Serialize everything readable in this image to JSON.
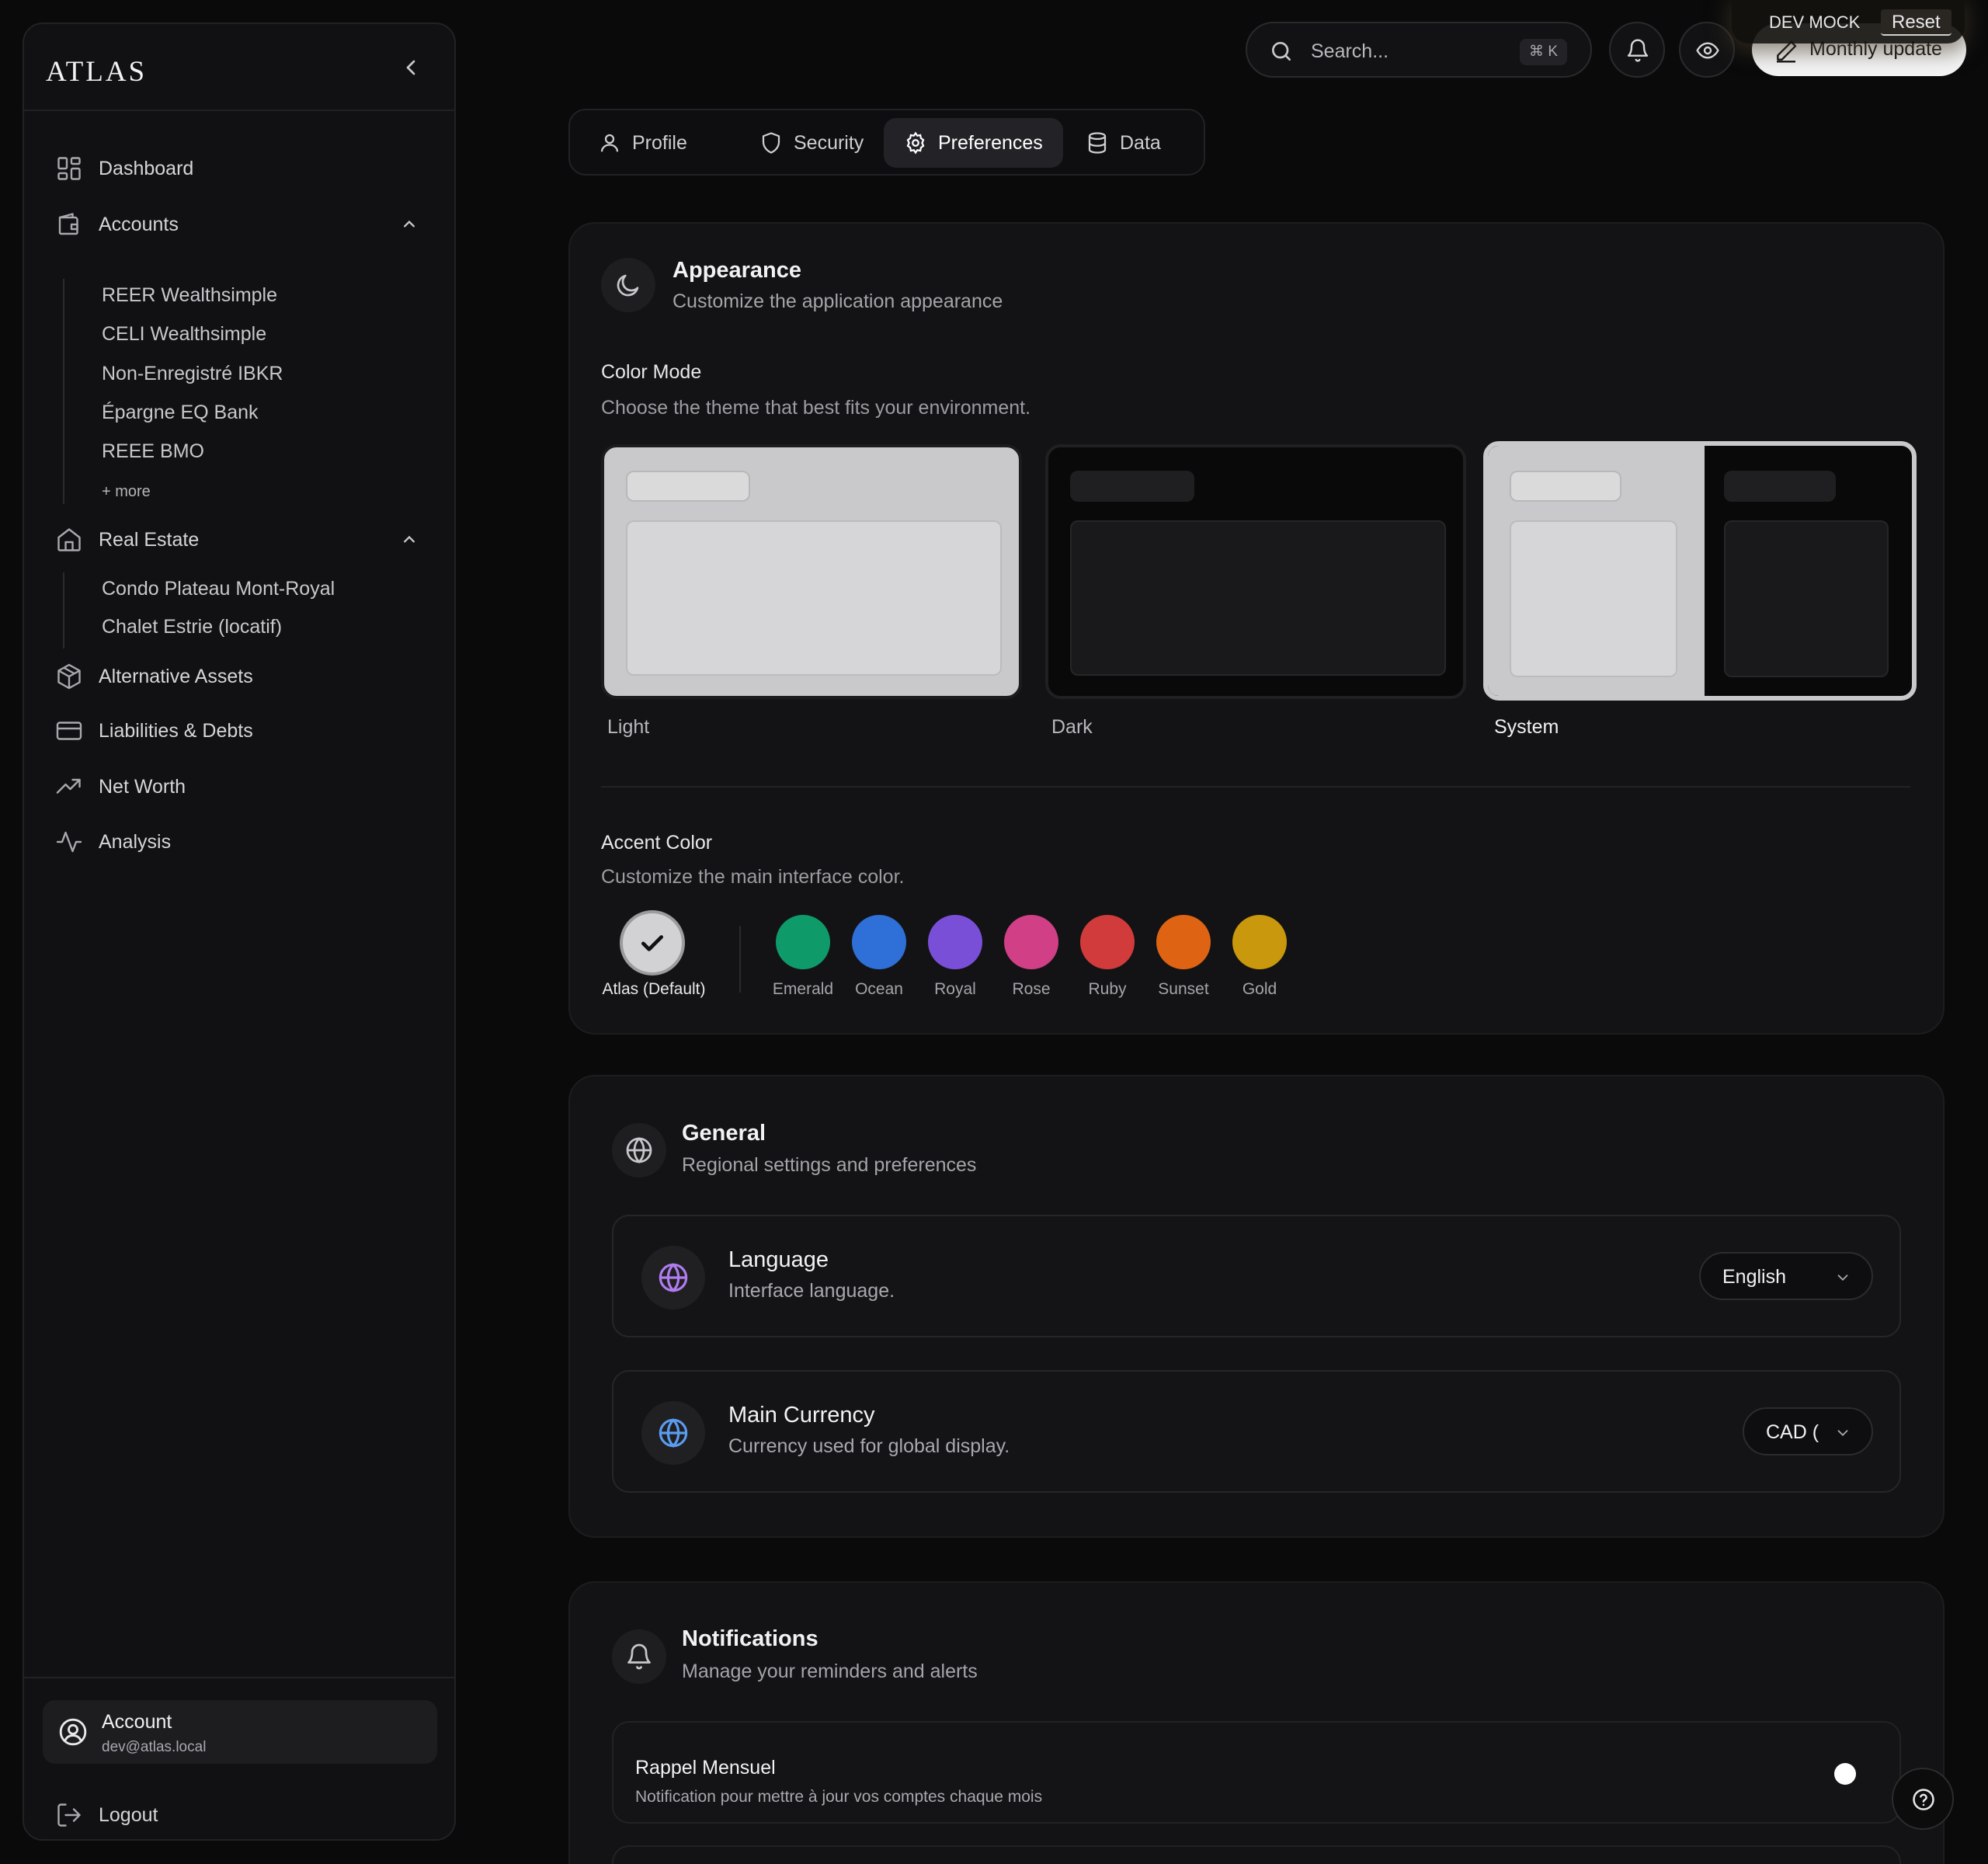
{
  "app": {
    "logo": "ATLAS"
  },
  "sidebar": {
    "dashboard": "Dashboard",
    "accounts": "Accounts",
    "account_items": [
      "REER Wealthsimple",
      "CELI Wealthsimple",
      "Non-Enregistré IBKR",
      "Épargne EQ Bank",
      "REEE BMO"
    ],
    "more": "+ more",
    "real_estate": "Real Estate",
    "real_estate_items": [
      "Condo Plateau Mont-Royal",
      "Chalet Estrie (locatif)"
    ],
    "alternative": "Alternative Assets",
    "liabilities": "Liabilities & Debts",
    "net_worth": "Net Worth",
    "analysis": "Analysis",
    "account": {
      "name": "Account",
      "email": "dev@atlas.local"
    },
    "logout": "Logout"
  },
  "topbar": {
    "search_placeholder": "Search...",
    "shortcut": "⌘ K",
    "monthly_update": "Monthly update",
    "dev_mock": "DEV MOCK",
    "reset": "Reset"
  },
  "tabs": [
    "Profile",
    "Security",
    "Preferences",
    "Data"
  ],
  "active_tab": "Preferences",
  "appearance": {
    "title": "Appearance",
    "subtitle": "Customize the application appearance",
    "color_mode": {
      "title": "Color Mode",
      "subtitle": "Choose the theme that best fits your environment.",
      "options": [
        "Light",
        "Dark",
        "System"
      ],
      "selected": "System"
    },
    "accent": {
      "title": "Accent Color",
      "subtitle": "Customize the main interface color.",
      "default_label": "Atlas (Default)",
      "selected": "Atlas (Default)",
      "colors": [
        {
          "name": "Emerald",
          "hex": "#0f9a6a"
        },
        {
          "name": "Ocean",
          "hex": "#2f6fd8"
        },
        {
          "name": "Royal",
          "hex": "#7a4fd8"
        },
        {
          "name": "Rose",
          "hex": "#d13f86"
        },
        {
          "name": "Ruby",
          "hex": "#d23b3b"
        },
        {
          "name": "Sunset",
          "hex": "#de6414"
        },
        {
          "name": "Gold",
          "hex": "#c9980c"
        }
      ]
    }
  },
  "general": {
    "title": "General",
    "subtitle": "Regional settings and preferences",
    "language": {
      "title": "Language",
      "subtitle": "Interface language.",
      "value": "English",
      "icon_color": "#b07cf0"
    },
    "currency": {
      "title": "Main Currency",
      "subtitle": "Currency used for global display.",
      "value": "CAD (",
      "icon_color": "#5a9cf0"
    }
  },
  "notifications": {
    "title": "Notifications",
    "subtitle": "Manage your reminders and alerts",
    "items": [
      {
        "title": "Rappel Mensuel",
        "subtitle": "Notification pour mettre à jour vos comptes chaque mois"
      }
    ]
  }
}
